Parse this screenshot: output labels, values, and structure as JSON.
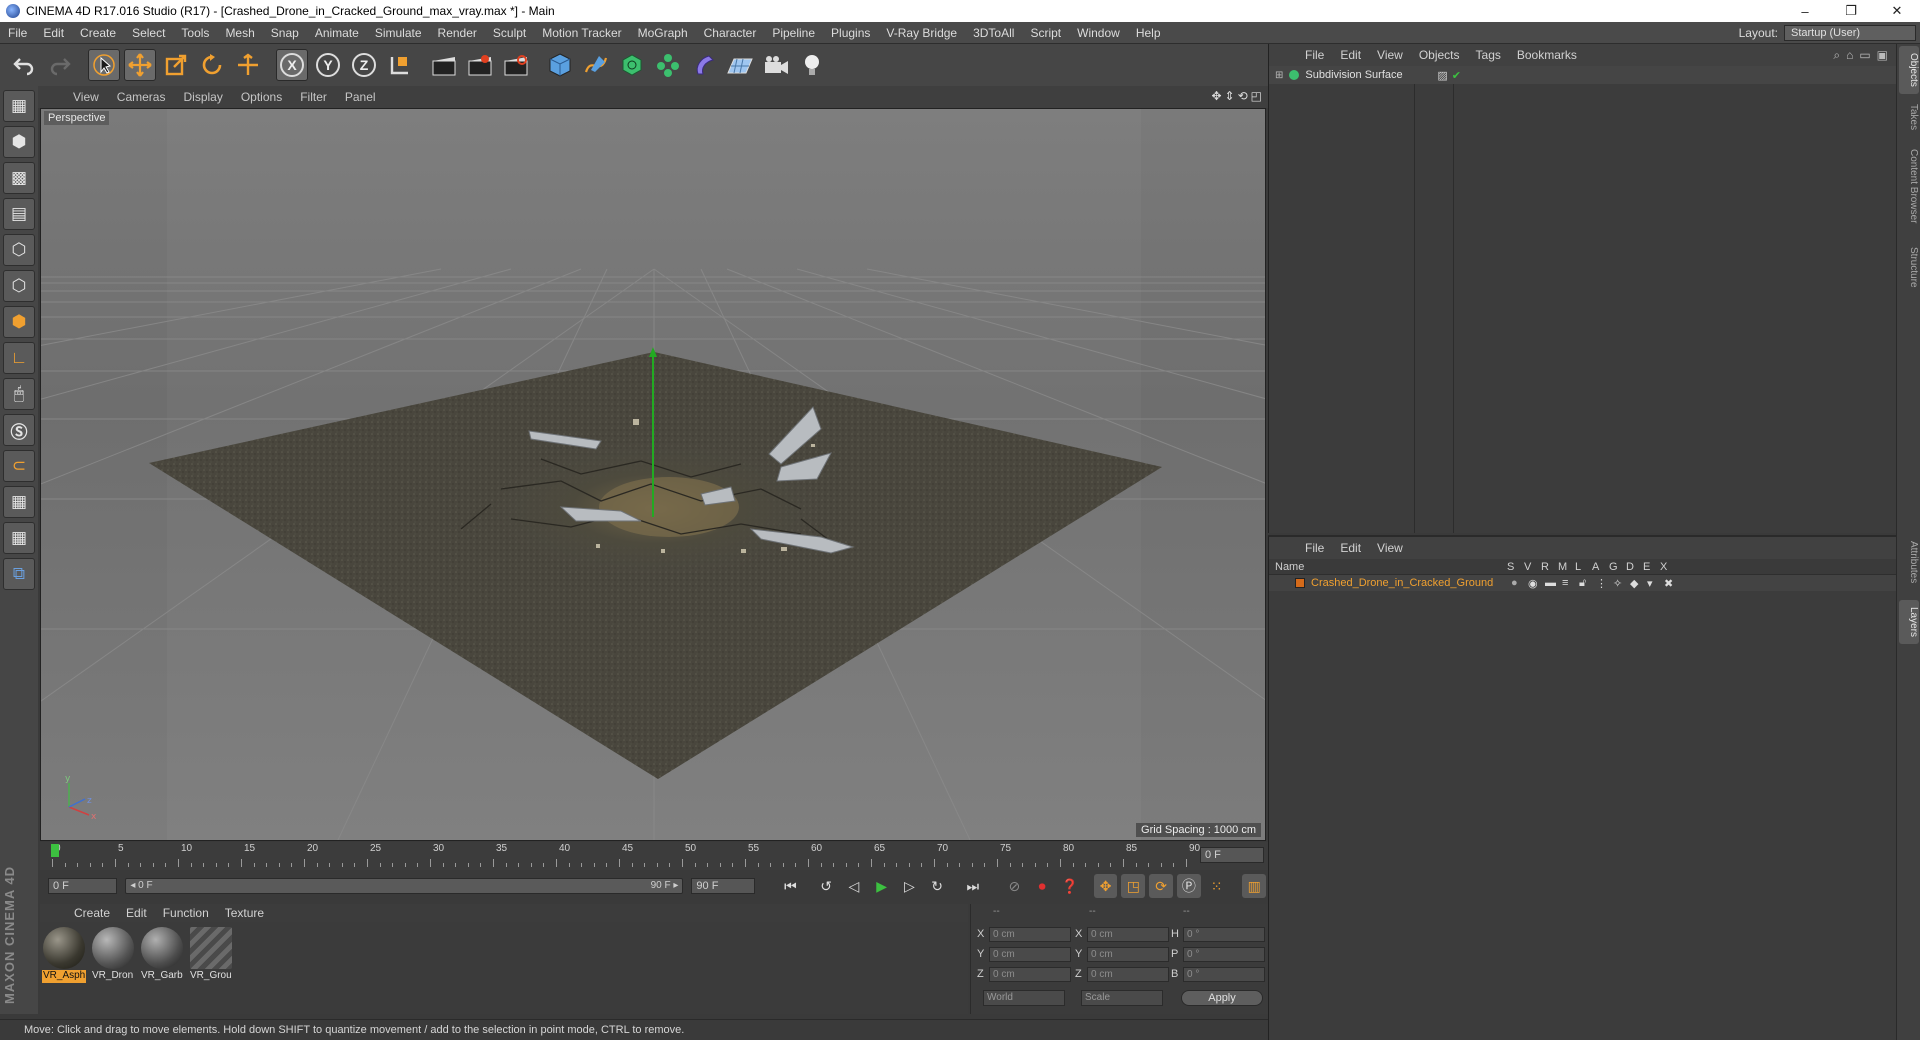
{
  "window": {
    "title": "CINEMA 4D R17.016 Studio (R17) - [Crashed_Drone_in_Cracked_Ground_max_vray.max *] - Main",
    "controls": [
      "–",
      "❐",
      "✕"
    ]
  },
  "menubar": {
    "items": [
      "File",
      "Edit",
      "Create",
      "Select",
      "Tools",
      "Mesh",
      "Snap",
      "Animate",
      "Simulate",
      "Render",
      "Sculpt",
      "Motion Tracker",
      "MoGraph",
      "Character",
      "Pipeline",
      "Plugins",
      "V-Ray Bridge",
      "3DToAll",
      "Script",
      "Window",
      "Help"
    ],
    "layout_label": "Layout:",
    "layout_value": "Startup (User)"
  },
  "toolbar": {
    "axis_x": "X",
    "axis_y": "Y",
    "axis_z": "Z"
  },
  "viewport": {
    "menu": [
      "View",
      "Cameras",
      "Display",
      "Options",
      "Filter",
      "Panel"
    ],
    "label": "Perspective",
    "grid_spacing": "Grid Spacing : 1000 cm",
    "axis_labels": {
      "x": "x",
      "y": "y",
      "z": "z"
    }
  },
  "timeline": {
    "ticks": [
      "0",
      "5",
      "10",
      "15",
      "20",
      "25",
      "30",
      "35",
      "40",
      "45",
      "50",
      "55",
      "60",
      "65",
      "70",
      "75",
      "80",
      "85",
      "90"
    ],
    "current_frame": "0 F"
  },
  "transport": {
    "start_field": "0 F",
    "range_start": "◂ 0 F",
    "range_end": "90 F ▸",
    "end_field": "90 F"
  },
  "material_manager": {
    "menu": [
      "Create",
      "Edit",
      "Function",
      "Texture"
    ],
    "materials": [
      {
        "name": "VR_Asph",
        "selected": true
      },
      {
        "name": "VR_Dron",
        "selected": false
      },
      {
        "name": "VR_Garb",
        "selected": false
      },
      {
        "name": "VR_Grou",
        "selected": false
      }
    ]
  },
  "coordinates": {
    "header": [
      "--",
      "--",
      "--"
    ],
    "rows": [
      {
        "l1": "X",
        "v1": "0 cm",
        "l2": "X",
        "v2": "0 cm",
        "l3": "H",
        "v3": "0 °"
      },
      {
        "l1": "Y",
        "v1": "0 cm",
        "l2": "Y",
        "v2": "0 cm",
        "l3": "P",
        "v3": "0 °"
      },
      {
        "l1": "Z",
        "v1": "0 cm",
        "l2": "Z",
        "v2": "0 cm",
        "l3": "B",
        "v3": "0 °"
      }
    ],
    "mode_world": "World",
    "mode_scale": "Scale",
    "apply": "Apply"
  },
  "object_manager": {
    "menu": [
      "File",
      "Edit",
      "View",
      "Objects",
      "Tags",
      "Bookmarks"
    ],
    "objects": [
      {
        "name": "Subdivision Surface"
      }
    ]
  },
  "layer_manager": {
    "menu": [
      "File",
      "Edit",
      "View"
    ],
    "columns": [
      "Name",
      "S",
      "V",
      "R",
      "M",
      "L",
      "A",
      "G",
      "D",
      "E",
      "X"
    ],
    "layers": [
      {
        "name": "Crashed_Drone_in_Cracked_Ground",
        "color": "#d46a1a"
      }
    ]
  },
  "right_tabs": [
    "Objects",
    "Takes",
    "Content Browser",
    "Structure",
    "Attributes",
    "Layers"
  ],
  "status_bar": "Move: Click and drag to move elements. Hold down SHIFT to quantize movement / add to the selection in point mode, CTRL to remove.",
  "brand": "MAXON CINEMA 4D",
  "colors": {
    "accent_orange": "#f0a030",
    "layer_color": "#d46a1a",
    "ui_bg": "#3c3c3c"
  }
}
